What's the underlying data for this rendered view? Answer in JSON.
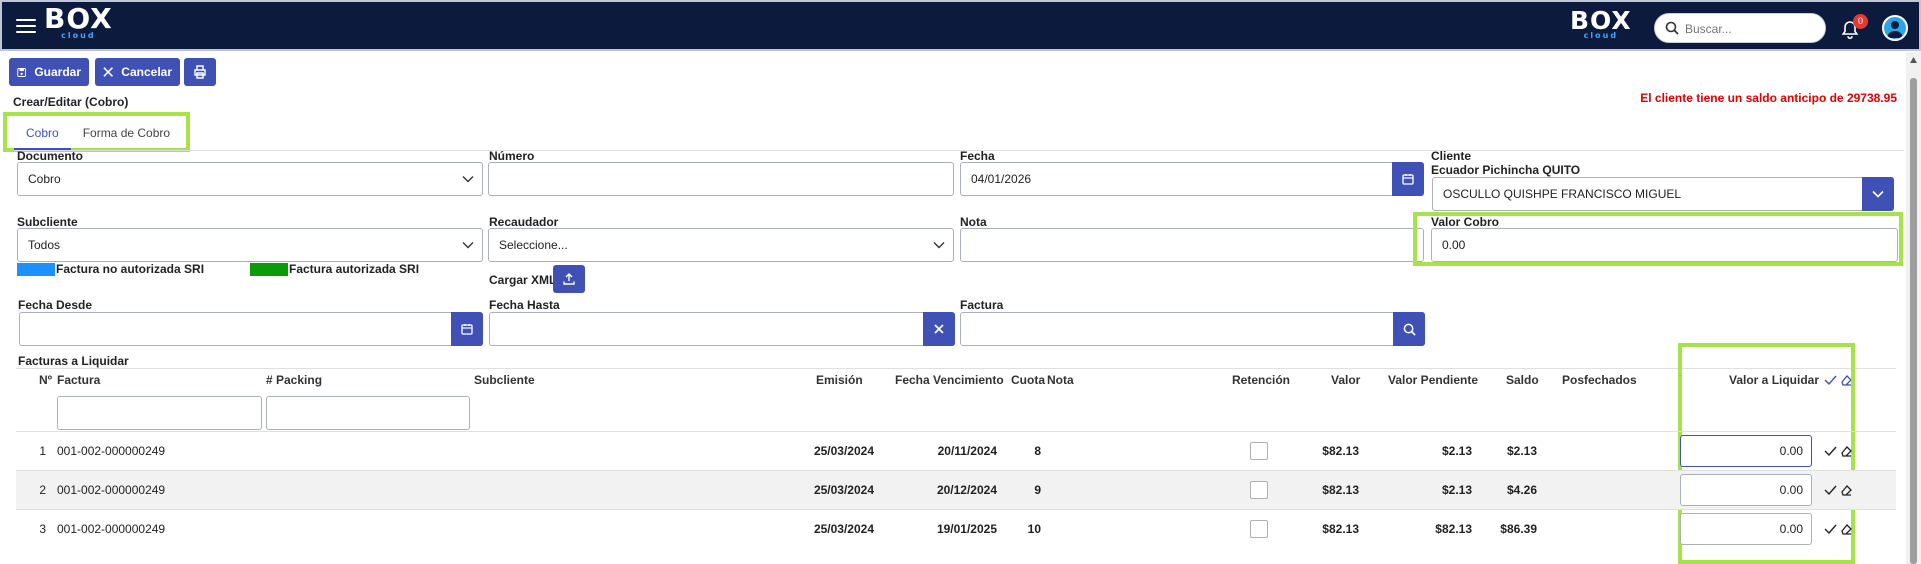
{
  "header": {
    "logo_text": "BOX",
    "logo_sub": "cloud",
    "search_placeholder": "Buscar...",
    "notifications_count": "0"
  },
  "toolbar": {
    "save_label": "Guardar",
    "cancel_label": "Cancelar"
  },
  "page": {
    "breadcrumb": "Crear/Editar (Cobro)",
    "warning": "El cliente tiene un saldo anticipo de 29738.95"
  },
  "tabs": [
    {
      "label": "Cobro",
      "active": true
    },
    {
      "label": "Forma de Cobro",
      "active": false
    }
  ],
  "form": {
    "documento": {
      "label": "Documento",
      "value": "Cobro"
    },
    "numero": {
      "label": "Número",
      "value": ""
    },
    "fecha": {
      "label": "Fecha",
      "value": "04/01/2026"
    },
    "cliente": {
      "label": "Cliente",
      "sublabel": "Ecuador Pichincha QUITO",
      "value": "OSCULLO QUISHPE FRANCISCO MIGUEL"
    },
    "subcliente": {
      "label": "Subcliente",
      "value": "Todos"
    },
    "recaudador": {
      "label": "Recaudador",
      "value": "Seleccione..."
    },
    "nota": {
      "label": "Nota",
      "value": ""
    },
    "valor_cobro": {
      "label": "Valor Cobro",
      "value": "0.00"
    },
    "legend_no_auth": "Factura no autorizada SRI",
    "legend_auth": "Factura autorizada SRI",
    "cargar_xml": "Cargar XML",
    "fecha_desde": {
      "label": "Fecha Desde",
      "value": ""
    },
    "fecha_hasta": {
      "label": "Fecha Hasta",
      "value": ""
    },
    "factura": {
      "label": "Factura",
      "value": ""
    }
  },
  "colors": {
    "header_bg": "#0c1a3e",
    "primary": "#3f51b5",
    "legend_no_auth": "#1e90ff",
    "legend_auth": "#0a9a0a",
    "warning": "#e00000",
    "highlight": "#a6e34a"
  },
  "table": {
    "title": "Facturas a Liquidar",
    "columns": {
      "no": "Nº",
      "factura": "Factura",
      "packing": "# Packing",
      "subcliente": "Subcliente",
      "emision": "Emisión",
      "vencimiento": "Fecha Vencimiento",
      "cuota": "Cuota",
      "nota": "Nota",
      "retencion": "Retención",
      "valor": "Valor",
      "pendiente": "Valor Pendiente",
      "saldo": "Saldo",
      "posfechados": "Posfechados",
      "liquidar": "Valor a Liquidar"
    },
    "rows": [
      {
        "no": "1",
        "factura": "001-002-000000249",
        "emision": "25/03/2024",
        "vencimiento": "20/11/2024",
        "cuota": "8",
        "valor": "$82.13",
        "pendiente": "$2.13",
        "saldo": "$2.13",
        "liquidar": "0.00"
      },
      {
        "no": "2",
        "factura": "001-002-000000249",
        "emision": "25/03/2024",
        "vencimiento": "20/12/2024",
        "cuota": "9",
        "valor": "$82.13",
        "pendiente": "$2.13",
        "saldo": "$4.26",
        "liquidar": "0.00"
      },
      {
        "no": "3",
        "factura": "001-002-000000249",
        "emision": "25/03/2024",
        "vencimiento": "19/01/2025",
        "cuota": "10",
        "valor": "$82.13",
        "pendiente": "$82.13",
        "saldo": "$86.39",
        "liquidar": "0.00"
      }
    ]
  }
}
